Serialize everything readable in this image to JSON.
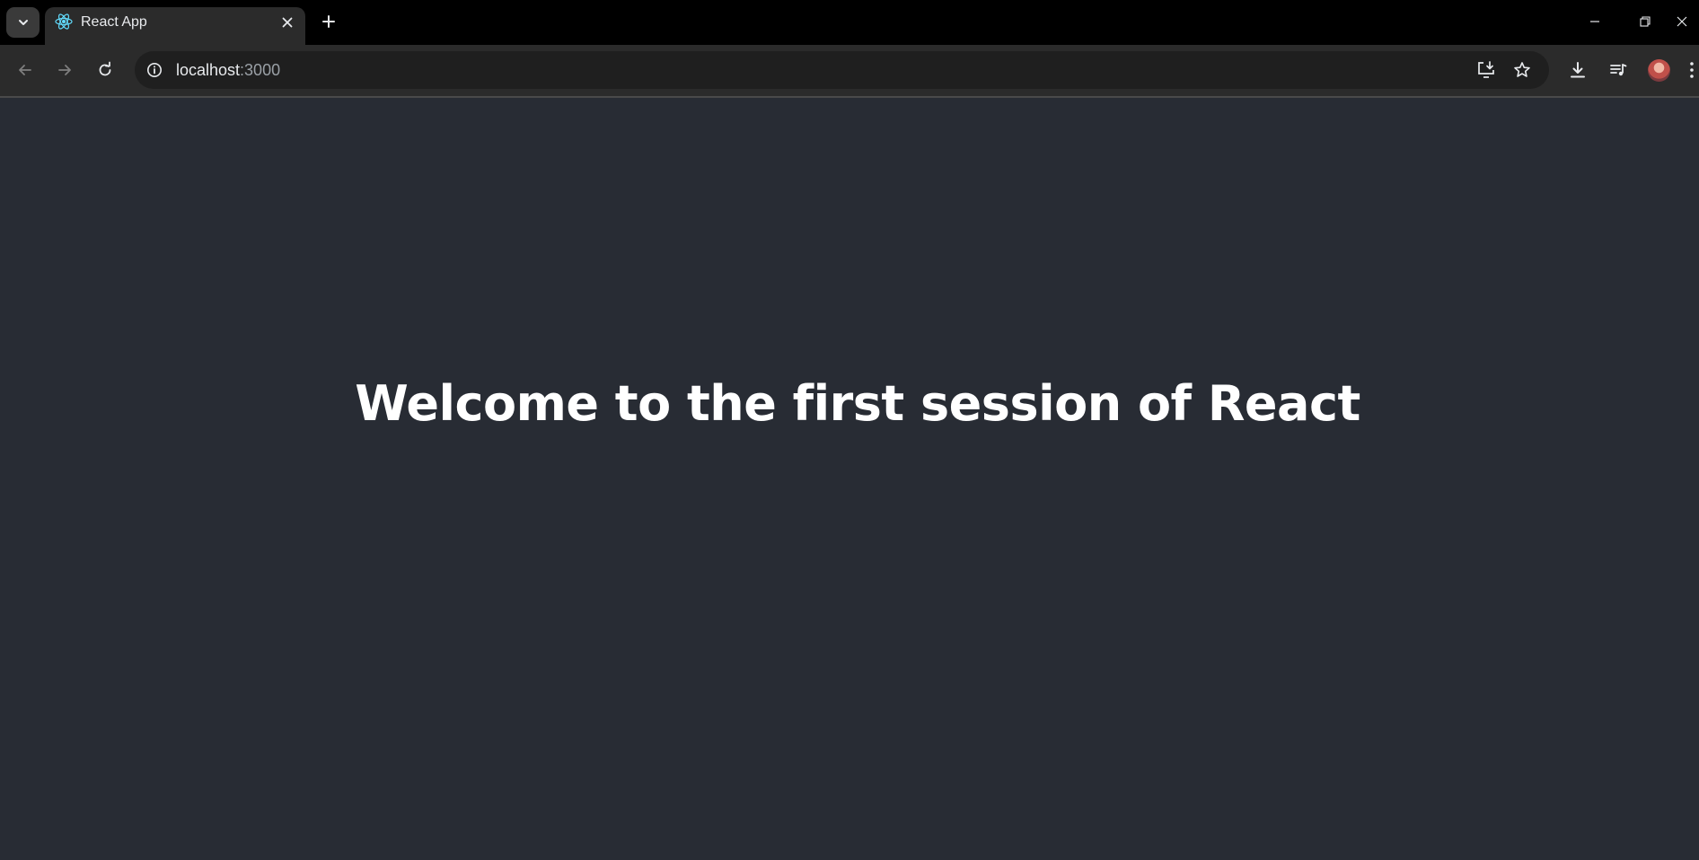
{
  "browser": {
    "tab": {
      "title": "React App",
      "favicon": "react-logo-icon"
    },
    "omnibox": {
      "host": "localhost",
      "port": ":3000"
    },
    "icons": {
      "tab_search": "chevron-down-icon",
      "close_tab": "close-icon",
      "new_tab": "plus-icon",
      "back": "arrow-left-icon",
      "forward": "arrow-right-icon",
      "reload": "reload-icon",
      "site_info": "info-icon",
      "install_app": "install-app-icon",
      "bookmark": "star-icon",
      "downloads": "download-icon",
      "media": "media-control-icon",
      "profile": "avatar",
      "minimize": "minimize-icon",
      "restore": "restore-icon",
      "close_window": "close-icon",
      "menu": "more-vertical-icon"
    }
  },
  "page": {
    "heading": "Welcome to the first session of React",
    "background": "#282c34",
    "text_color": "#ffffff"
  }
}
